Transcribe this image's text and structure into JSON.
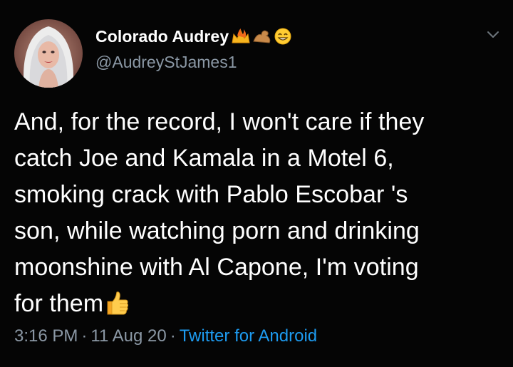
{
  "tweet": {
    "author": {
      "display_name": "Colorado Audrey",
      "handle": "@AudreyStJames1",
      "name_emojis": [
        "fire-crown-icon",
        "flexed-arm-icon",
        "smiling-face-icon"
      ]
    },
    "text_lines": [
      "And, for the record, I won't care if they",
      "catch Joe and Kamala in a Motel 6,",
      "smoking crack with Pablo Escobar 's",
      "son, while watching porn and drinking",
      "moonshine with Al Capone, I'm voting",
      "for them"
    ],
    "trailing_emoji": "thumbs-up-icon",
    "time": "3:16 PM",
    "separator": "·",
    "date": "11 Aug 20",
    "source": "Twitter for Android"
  },
  "colors": {
    "background": "#050505",
    "text": "#ffffff",
    "secondary_text": "#8b98a5",
    "link": "#1d9bf0"
  }
}
